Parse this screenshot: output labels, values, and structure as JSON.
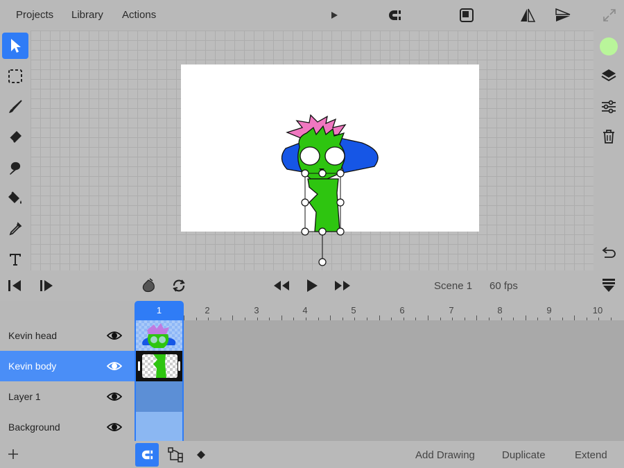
{
  "menu": {
    "projects": "Projects",
    "library": "Library",
    "actions": "Actions"
  },
  "icons": {
    "play": "play-icon",
    "magnet": "magnet-icon",
    "frame": "frame-icon",
    "flip_h": "flip-horizontal-icon",
    "flip_v": "flip-vertical-icon",
    "fullscreen": "fullscreen-icon"
  },
  "tools": [
    "select-arrow-icon",
    "marquee-select-icon",
    "brush-icon",
    "eraser-icon",
    "smudge-icon",
    "fill-bucket-icon",
    "eyedropper-icon",
    "text-tool-icon"
  ],
  "colors": {
    "accent": "#2f7cf6",
    "current_color": "#b9f59a"
  },
  "transport": {
    "scene": "Scene 1",
    "fps": "60 fps"
  },
  "timeline": {
    "current_frame": "1",
    "frame_numbers": [
      "2",
      "3",
      "4",
      "5",
      "6",
      "7",
      "8",
      "9",
      "10"
    ],
    "layers": [
      {
        "name": "Kevin head",
        "selected": false
      },
      {
        "name": "Kevin body",
        "selected": true
      },
      {
        "name": "Layer 1",
        "selected": false
      },
      {
        "name": "Background",
        "selected": false
      }
    ]
  },
  "bottom": {
    "add_drawing": "Add Drawing",
    "duplicate": "Duplicate",
    "extend": "Extend"
  }
}
